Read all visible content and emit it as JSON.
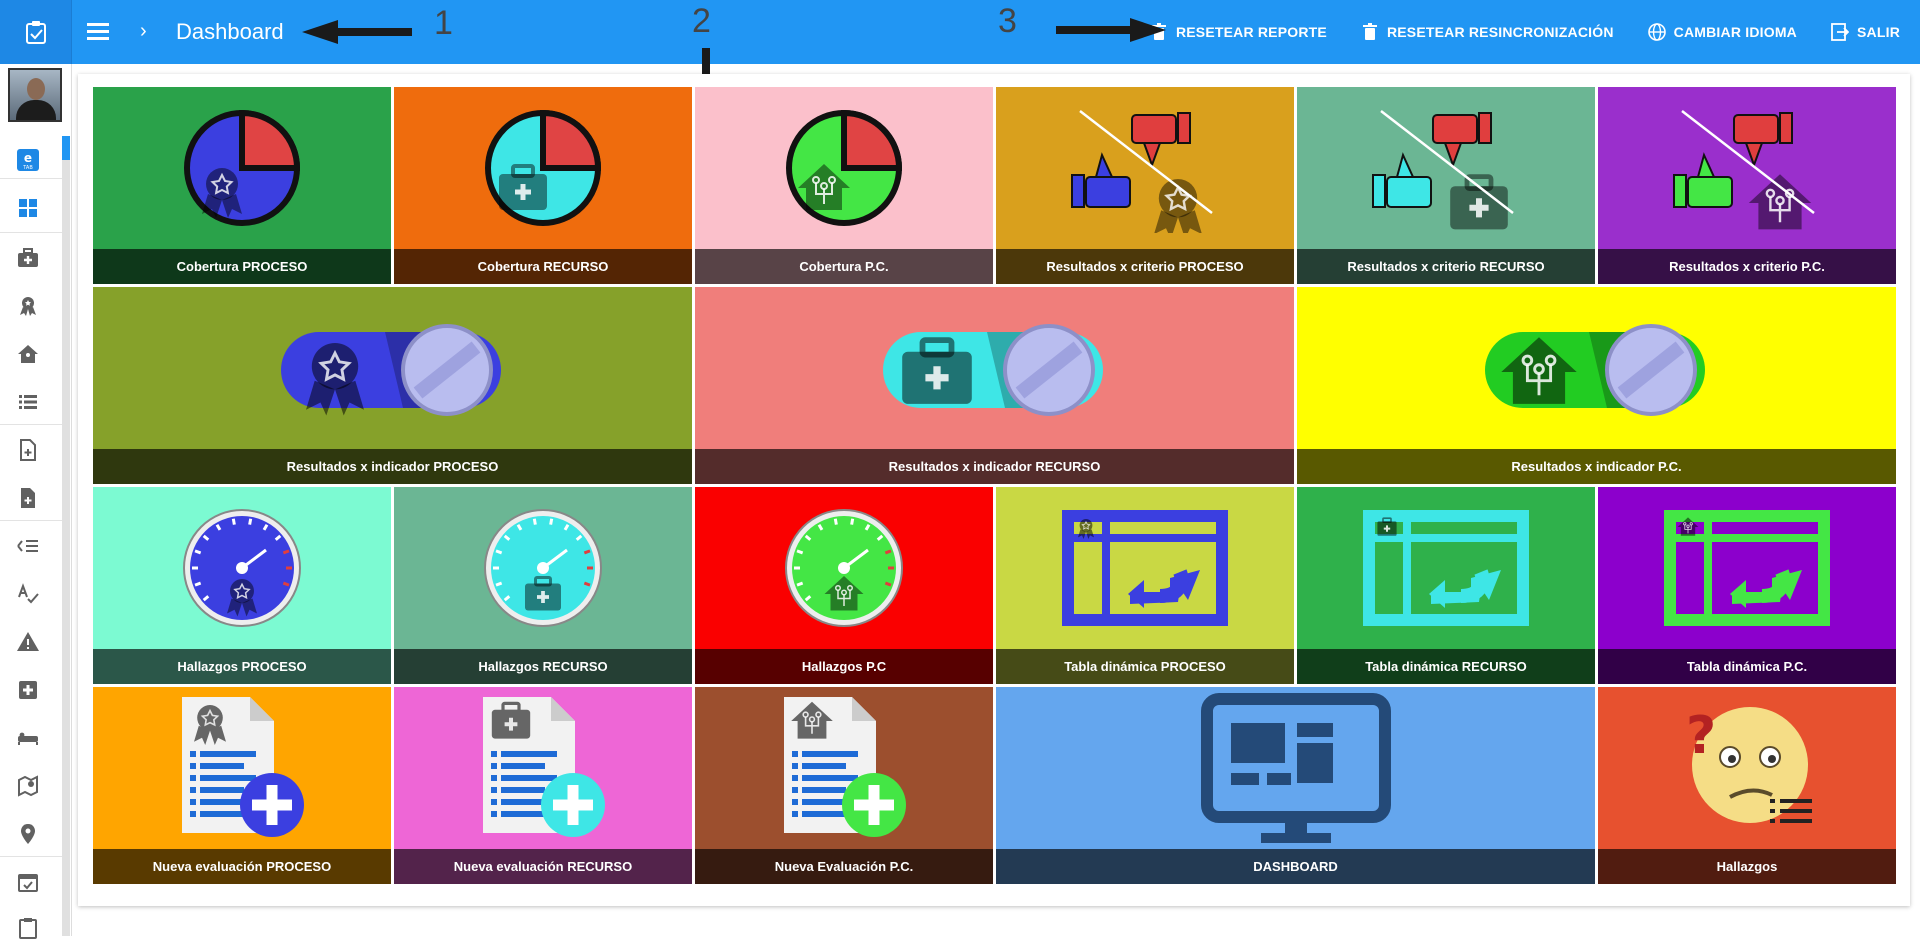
{
  "header": {
    "title": "Dashboard",
    "actions": [
      {
        "label": "RESETEAR REPORTE",
        "icon": "trash-icon"
      },
      {
        "label": "RESETEAR RESINCRONIZACIÓN",
        "icon": "trash-icon"
      },
      {
        "label": "CAMBIAR IDIOMA",
        "icon": "globe-icon"
      },
      {
        "label": "SALIR",
        "icon": "logout-icon"
      }
    ]
  },
  "annotations": [
    "1",
    "2",
    "3"
  ],
  "sidebar": {
    "items": [
      "dashboard-grid-icon",
      "medical-bag-icon",
      "award-icon",
      "home-network-icon",
      "list-icon",
      "file-plus-outline-icon",
      "file-plus-icon",
      "checklist-icon",
      "spellcheck-icon",
      "alert-icon",
      "medical-cross-icon",
      "bed-icon",
      "map-marker-outline-icon",
      "map-marker-icon",
      "calendar-check-icon",
      "clipboard-icon"
    ]
  },
  "colors": {
    "header": "#2196f3",
    "accent": "#2196f3"
  },
  "tiles": [
    {
      "label": "Cobertura PROCESO",
      "bg": "#2aa24a",
      "icon": "pie-award-icon",
      "c1": "#3b3fe0"
    },
    {
      "label": "Cobertura RECURSO",
      "bg": "#ef6c0d",
      "icon": "pie-medical-bag-icon",
      "c1": "#3ee6e6"
    },
    {
      "label": "Cobertura P.C.",
      "bg": "#fbc0cb",
      "icon": "pie-home-icon",
      "c1": "#44e645"
    },
    {
      "label": "Resultados x criterio PROCESO",
      "bg": "#d9a01d",
      "icon": "thumbs-award-icon",
      "c1": "#3b3fe0"
    },
    {
      "label": "Resultados x criterio RECURSO",
      "bg": "#6bb694",
      "icon": "thumbs-medical-bag-icon",
      "c1": "#3ee6e6"
    },
    {
      "label": "Resultados x criterio P.C.",
      "bg": "#9a2fcc",
      "icon": "thumbs-home-icon",
      "c1": "#44e645"
    },
    {
      "label": "Resultados x indicador PROCESO",
      "bg": "#86a12a",
      "icon": "toggle-award-icon",
      "c1": "#3b3fe0",
      "span": 2
    },
    {
      "label": "Resultados x indicador RECURSO",
      "bg": "#f07e7b",
      "icon": "toggle-medical-bag-icon",
      "c1": "#3ee6e6",
      "span": 2
    },
    {
      "label": "Resultados x indicador P.C.",
      "bg": "#ffff00",
      "icon": "toggle-home-icon",
      "c1": "#22cc22",
      "span": 2
    },
    {
      "label": "Hallazgos PROCESO",
      "bg": "#7cfad2",
      "icon": "gauge-award-icon",
      "c1": "#3b3fe0"
    },
    {
      "label": "Hallazgos RECURSO",
      "bg": "#6bb694",
      "icon": "gauge-medical-bag-icon",
      "c1": "#3ee6e6"
    },
    {
      "label": "Hallazgos P.C",
      "bg": "#fa0000",
      "icon": "gauge-home-icon",
      "c1": "#44e645"
    },
    {
      "label": "Tabla dinámica PROCESO",
      "bg": "#c9d844",
      "icon": "pivot-award-icon",
      "c1": "#3b3fe0"
    },
    {
      "label": "Tabla dinámica RECURSO",
      "bg": "#2fb14b",
      "icon": "pivot-medical-bag-icon",
      "c1": "#3ee6e6"
    },
    {
      "label": "Tabla dinámica P.C.",
      "bg": "#8c00cc",
      "icon": "pivot-home-icon",
      "c1": "#44e645"
    },
    {
      "label": "Nueva evaluación PROCESO",
      "bg": "#ffa500",
      "icon": "doc-add-award-icon",
      "c1": "#3b3fe0"
    },
    {
      "label": "Nueva evaluación RECURSO",
      "bg": "#ee66d6",
      "icon": "doc-add-medical-bag-icon",
      "c1": "#3ee6e6"
    },
    {
      "label": "Nueva Evaluación P.C.",
      "bg": "#9c4f2e",
      "icon": "doc-add-home-icon",
      "c1": "#44e645"
    },
    {
      "label": "DASHBOARD",
      "bg": "#64a6ee",
      "icon": "monitor-dashboard-icon",
      "c1": "#244a78",
      "span": 2
    },
    {
      "label": "Hallazgos",
      "bg": "#e7512f",
      "icon": "confused-face-icon",
      "c1": "#f5dd86"
    }
  ]
}
